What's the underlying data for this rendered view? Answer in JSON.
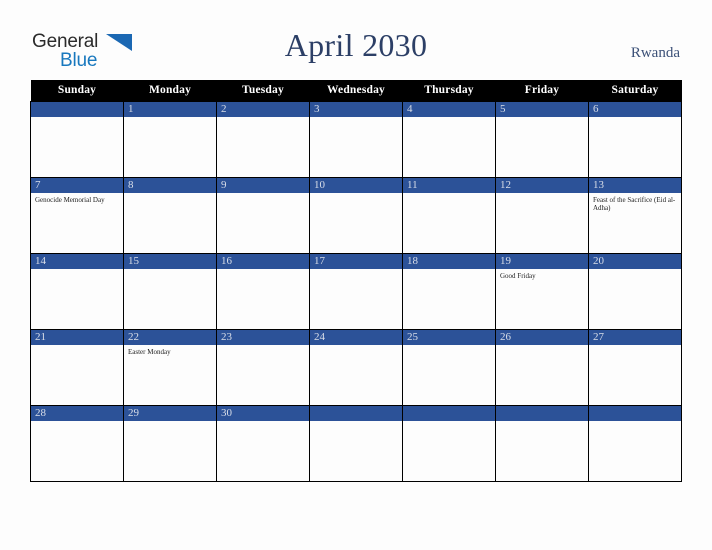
{
  "brand": {
    "name_part1": "General",
    "name_part2": "Blue",
    "triangle_color": "#1b68b3",
    "blue_text_color": "#1878be",
    "dark_text_color": "#2b2b2b"
  },
  "header": {
    "title": "April 2030",
    "country": "Rwanda",
    "title_color": "#2c3f66",
    "country_color": "#3c5178"
  },
  "theme": {
    "header_bar_bg": "#000000",
    "header_bar_text": "#ffffff",
    "daynum_bg": "#2c5298",
    "daynum_text": "#d9dee8",
    "cell_bg": "#fdfdfd",
    "grid_border": "#000000",
    "event_text": "#1d1d1d",
    "page_bg": "#fdfdfd"
  },
  "weekdays": [
    "Sunday",
    "Monday",
    "Tuesday",
    "Wednesday",
    "Thursday",
    "Friday",
    "Saturday"
  ],
  "weeks": [
    [
      {
        "day": "",
        "events": []
      },
      {
        "day": "1",
        "events": []
      },
      {
        "day": "2",
        "events": []
      },
      {
        "day": "3",
        "events": []
      },
      {
        "day": "4",
        "events": []
      },
      {
        "day": "5",
        "events": []
      },
      {
        "day": "6",
        "events": []
      }
    ],
    [
      {
        "day": "7",
        "events": [
          "Genocide Memorial Day"
        ]
      },
      {
        "day": "8",
        "events": []
      },
      {
        "day": "9",
        "events": []
      },
      {
        "day": "10",
        "events": []
      },
      {
        "day": "11",
        "events": []
      },
      {
        "day": "12",
        "events": []
      },
      {
        "day": "13",
        "events": [
          "Feast of the Sacrifice (Eid al-Adha)"
        ]
      }
    ],
    [
      {
        "day": "14",
        "events": []
      },
      {
        "day": "15",
        "events": []
      },
      {
        "day": "16",
        "events": []
      },
      {
        "day": "17",
        "events": []
      },
      {
        "day": "18",
        "events": []
      },
      {
        "day": "19",
        "events": [
          "Good Friday"
        ]
      },
      {
        "day": "20",
        "events": []
      }
    ],
    [
      {
        "day": "21",
        "events": []
      },
      {
        "day": "22",
        "events": [
          "Easter Monday"
        ]
      },
      {
        "day": "23",
        "events": []
      },
      {
        "day": "24",
        "events": []
      },
      {
        "day": "25",
        "events": []
      },
      {
        "day": "26",
        "events": []
      },
      {
        "day": "27",
        "events": []
      }
    ],
    [
      {
        "day": "28",
        "events": []
      },
      {
        "day": "29",
        "events": []
      },
      {
        "day": "30",
        "events": []
      },
      {
        "day": "",
        "events": []
      },
      {
        "day": "",
        "events": []
      },
      {
        "day": "",
        "events": []
      },
      {
        "day": "",
        "events": []
      }
    ]
  ]
}
